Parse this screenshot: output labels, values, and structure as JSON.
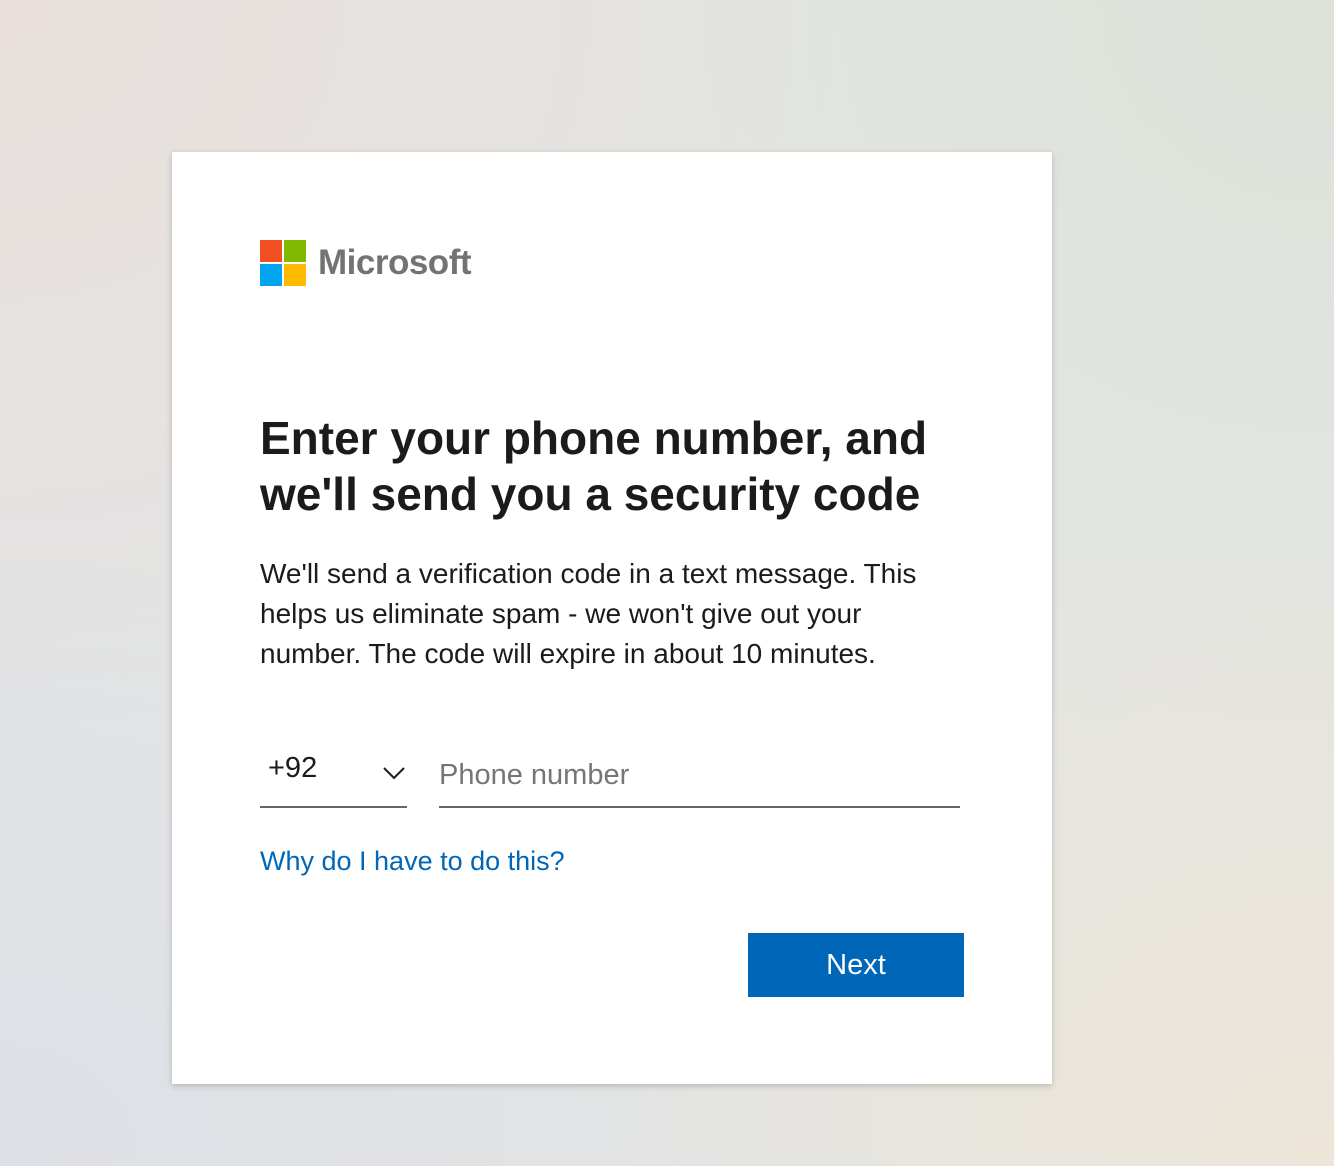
{
  "logo": {
    "text": "Microsoft",
    "colors": [
      "#f25022",
      "#7fba00",
      "#00a4ef",
      "#ffb900"
    ]
  },
  "heading": "Enter your phone number, and we'll send you a security code",
  "description": "We'll send a verification code in a text message. This helps us eliminate spam - we won't give out your number. The code will expire in about 10 minutes.",
  "country_select": {
    "value": "+92",
    "icon": "chevron-down-icon"
  },
  "phone_input": {
    "value": "",
    "placeholder": "Phone number"
  },
  "help_link": "Why do I have to do this?",
  "next_button": "Next",
  "colors": {
    "accent": "#0067b8",
    "text": "#1b1b1b",
    "logo_text": "#737373"
  }
}
